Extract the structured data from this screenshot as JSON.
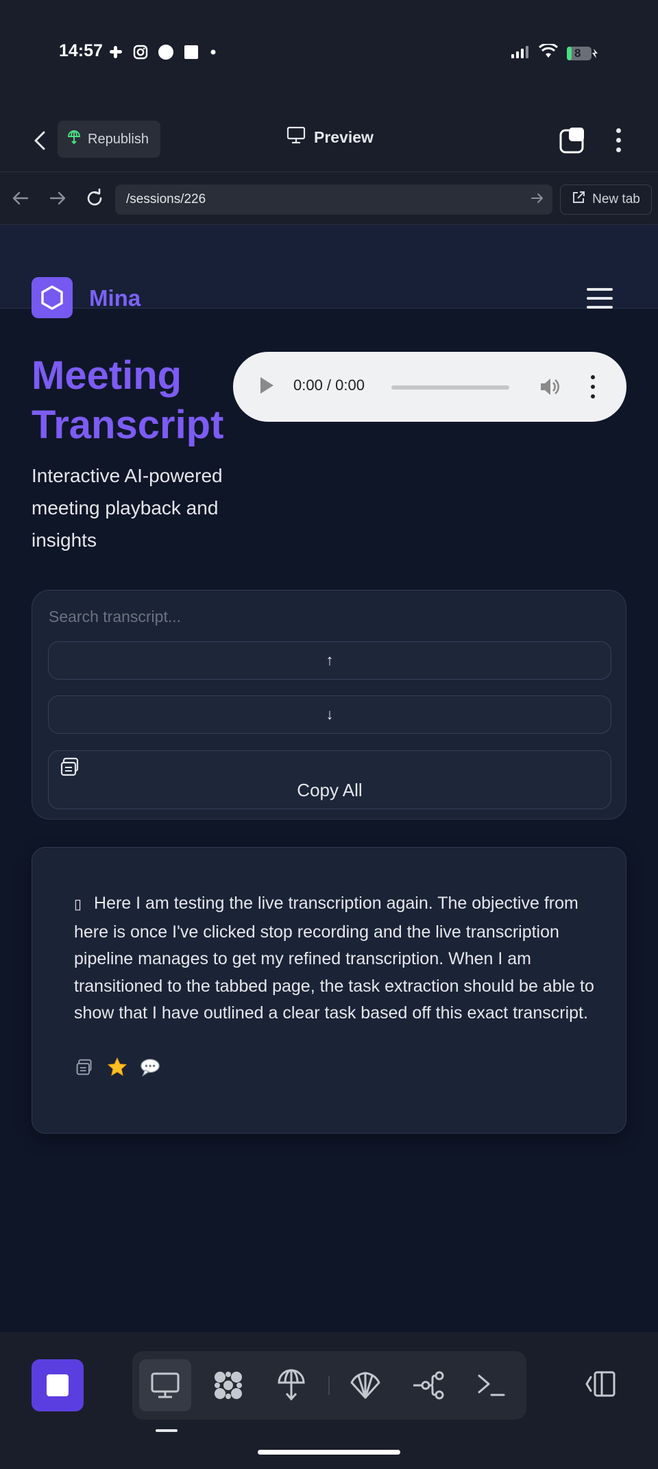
{
  "status_bar": {
    "time": "14:57",
    "battery_level": "8",
    "icons_left": [
      "slack-icon",
      "instagram-icon",
      "circle-icon",
      "square-icon",
      "dot-icon"
    ],
    "icons_right": [
      "signal-icon",
      "wifi-icon",
      "battery-icon"
    ]
  },
  "app_header": {
    "republish_label": "Republish",
    "preview_label": "Preview"
  },
  "browser": {
    "url": "/sessions/226",
    "new_tab_label": "New tab"
  },
  "site": {
    "name": "Mina"
  },
  "hero": {
    "title": "Meeting Transcript",
    "subtitle": "Interactive AI-powered meeting playback and insights"
  },
  "audio": {
    "time_display": "0:00 / 0:00",
    "progress": 0
  },
  "search": {
    "placeholder": "Search transcript...",
    "value": "",
    "prev_label": "↑",
    "next_label": "↓",
    "copy_all_label": "Copy All"
  },
  "transcript": {
    "marker": "▯",
    "text": "Here I am testing the live transcription again. The objective from here is once I've clicked stop recording and the live transcription pipeline manages to get my refined transcription. When I am transitioned to the tabbed page, the task extraction should be able to show that I have outlined a clear task based off this exact transcript.",
    "actions": [
      "copy-icon",
      "star-icon",
      "comment-icon"
    ]
  },
  "toolbar": {
    "tools": [
      "preview-monitor-icon",
      "agents-grid-icon",
      "publish-icon",
      "shell-icon",
      "workflow-icon",
      "terminal-icon"
    ],
    "active_tool": "preview-monitor-icon"
  },
  "colors": {
    "accent": "#7c5cf3",
    "background": "#0f1628",
    "card": "#1b2336",
    "chrome": "#1a1e2a",
    "stop_button": "#5b3ee0"
  }
}
